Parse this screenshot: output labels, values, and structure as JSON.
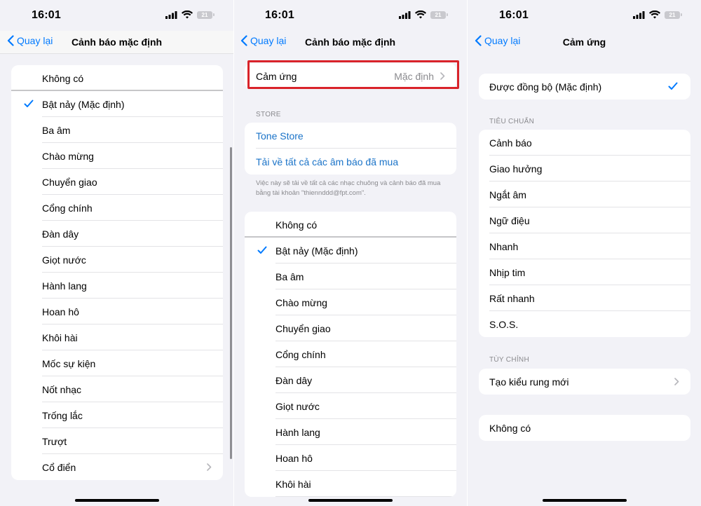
{
  "status": {
    "time": "16:01",
    "battery": "21"
  },
  "panel1": {
    "back_label": "Quay lại",
    "title": "Cảnh báo mặc định",
    "items": [
      {
        "label": "Không có"
      },
      {
        "label": "Bật nảy (Mặc định)",
        "selected": true
      },
      {
        "label": "Ba âm"
      },
      {
        "label": "Chào mừng"
      },
      {
        "label": "Chuyển giao"
      },
      {
        "label": "Cổng chính"
      },
      {
        "label": "Đàn dây"
      },
      {
        "label": "Giọt nước"
      },
      {
        "label": "Hành lang"
      },
      {
        "label": "Hoan hô"
      },
      {
        "label": "Khôi hài"
      },
      {
        "label": "Mốc sự kiện"
      },
      {
        "label": "Nốt nhạc"
      },
      {
        "label": "Trống lắc"
      },
      {
        "label": "Trượt"
      },
      {
        "label": "Cổ điển"
      }
    ]
  },
  "panel2": {
    "back_label": "Quay lại",
    "title": "Cảnh báo mặc định",
    "haptics": {
      "label": "Cảm ứng",
      "value": "Mặc định"
    },
    "store_header": "STORE",
    "store_items": [
      {
        "label": "Tone Store"
      },
      {
        "label": "Tải về tất cả các âm báo đã mua"
      }
    ],
    "store_footnote": "Việc này sẽ tải về tất cả các nhạc chuông và cảnh báo đã mua bằng tài khoản \"thiennddd@fpt.com\".",
    "items": [
      {
        "label": "Không có"
      },
      {
        "label": "Bật nảy (Mặc định)",
        "selected": true
      },
      {
        "label": "Ba âm"
      },
      {
        "label": "Chào mừng"
      },
      {
        "label": "Chuyển giao"
      },
      {
        "label": "Cổng chính"
      },
      {
        "label": "Đàn dây"
      },
      {
        "label": "Giọt nước"
      },
      {
        "label": "Hành lang"
      },
      {
        "label": "Hoan hô"
      },
      {
        "label": "Khôi hài"
      }
    ]
  },
  "panel3": {
    "back_label": "Quay lại",
    "title": "Cảm ứng",
    "synced": {
      "label": "Được đồng bộ (Mặc định)",
      "selected": true
    },
    "standard_header": "TIÊU CHUẨN",
    "standard_items": [
      {
        "label": "Cảnh báo"
      },
      {
        "label": "Giao hưởng"
      },
      {
        "label": "Ngắt âm"
      },
      {
        "label": "Ngữ điệu"
      },
      {
        "label": "Nhanh"
      },
      {
        "label": "Nhịp tim"
      },
      {
        "label": "Rất nhanh"
      },
      {
        "label": "S.O.S."
      }
    ],
    "custom_header": "TÙY CHỈNH",
    "create_vibration": "Tạo kiểu rung mới",
    "none_label": "Không có"
  },
  "colors": {
    "accent": "#007aff",
    "highlight": "#d9232a",
    "background": "#f2f2f7"
  }
}
